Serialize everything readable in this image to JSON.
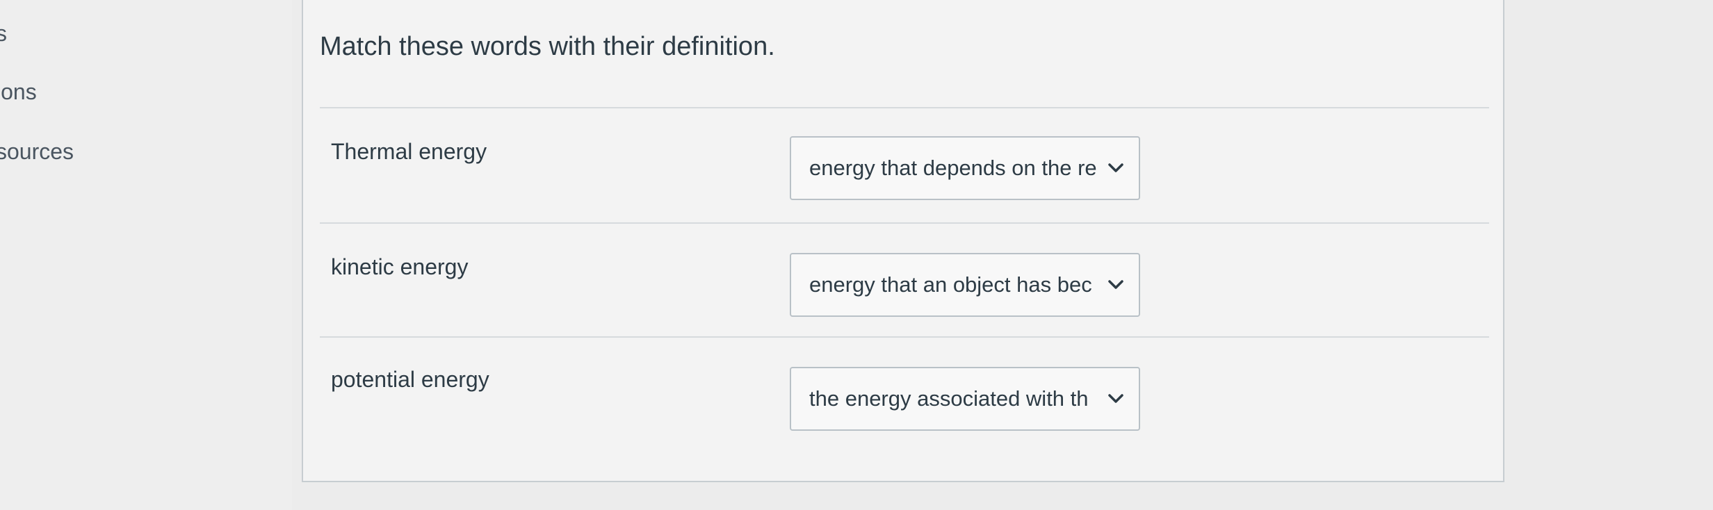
{
  "sidebar": {
    "items": [
      {
        "label": "s"
      },
      {
        "label": "ions"
      },
      {
        "label": "sources"
      }
    ]
  },
  "question": {
    "prompt": "Match these words with their definition.",
    "rows": [
      {
        "term": "Thermal energy",
        "selected": "energy that depends on the re"
      },
      {
        "term": "kinetic energy",
        "selected": "energy that an object has bec"
      },
      {
        "term": "potential energy",
        "selected": "the energy associated with th"
      }
    ]
  },
  "icons": {
    "dropdown": "chevron-down-icon"
  }
}
